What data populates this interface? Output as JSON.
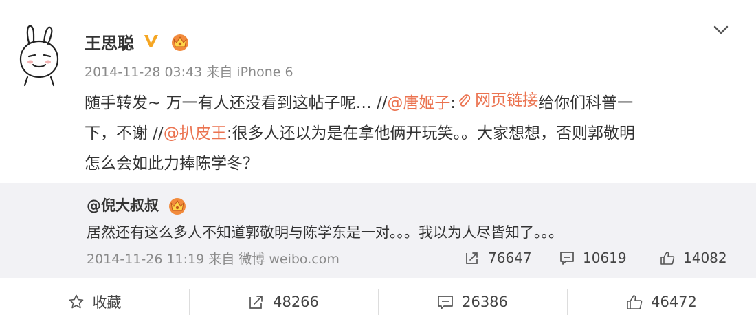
{
  "post": {
    "username": "王思聪",
    "timestamp": "2014-11-28 03:43",
    "source": "来自 iPhone 6",
    "text": {
      "line1_plain": "随手转发~ 万一有人还没看到这帖子呢… //",
      "line1_mention": "@唐姬子",
      "line1_sep": ":",
      "line1_link": "网页链接",
      "line1_tail": "给你们科普一",
      "line2_plain": "下，不谢 //",
      "line2_mention": "@扒皮王",
      "line2_tail": ":很多人还以为是在拿他俩开玩笑。。大家想想，否则郭敬明",
      "line3": "怎么会如此力捧陈学冬？"
    }
  },
  "repost": {
    "username": "@倪大叔叔",
    "text": "居然还有这么多人不知道郭敬明与陈学东是一对。。。我以为人尽皆知了。。。",
    "timestamp": "2014-11-26 11:19",
    "source": "来自 微博 weibo.com",
    "stats": {
      "reposts": "76647",
      "comments": "10619",
      "likes": "14082"
    }
  },
  "actions": {
    "favorite": "收藏",
    "reposts": "48266",
    "comments": "26386",
    "likes": "46472"
  },
  "colors": {
    "mention": "#eb7350",
    "badge_v": "#f5a623",
    "repost_bg": "#f2f2f5"
  },
  "icons": {
    "verified": "verified-v-icon",
    "crown": "vip-crown-icon",
    "chevron": "chevron-down-icon",
    "attachment": "paperclip-icon",
    "repost": "repost-icon",
    "comment": "comment-icon",
    "like": "thumbs-up-icon",
    "favorite": "star-icon"
  }
}
